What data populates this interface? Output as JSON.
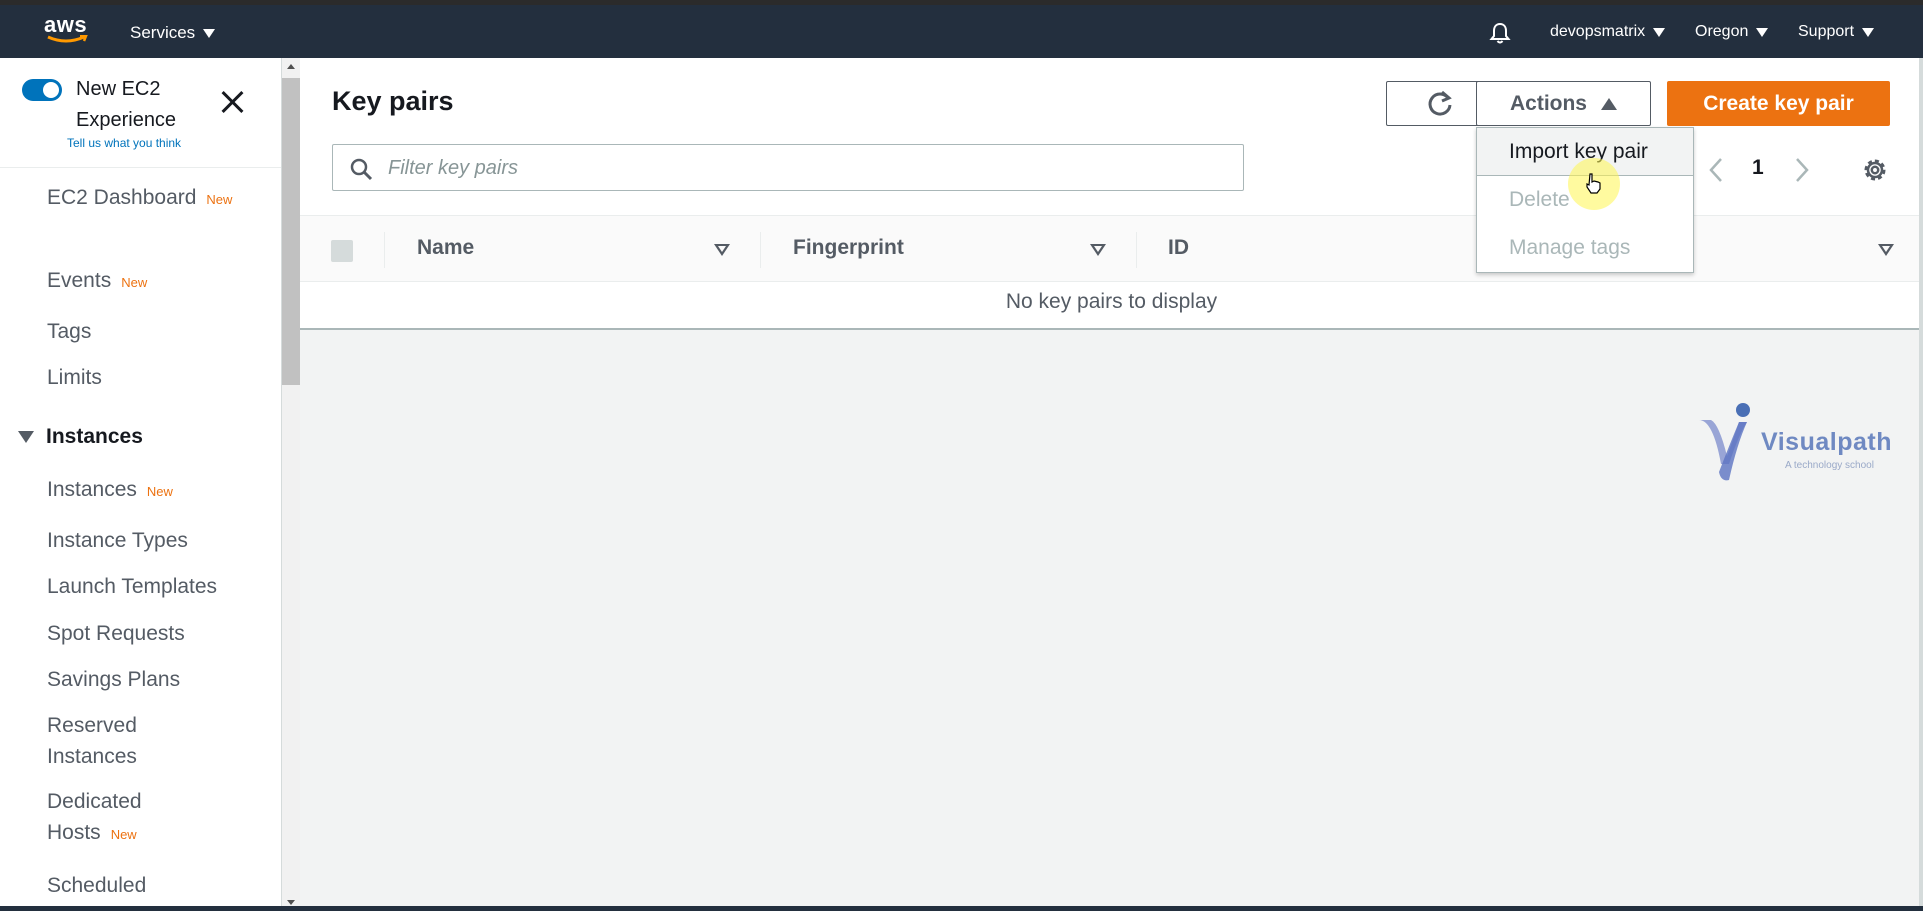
{
  "topbar": {
    "logo_text": "aws",
    "services_label": "Services",
    "account_label": "devopsmatrix",
    "region_label": "Oregon",
    "support_label": "Support"
  },
  "sidebar": {
    "experience_title": "New EC2 Experience",
    "experience_link": "Tell us what you think",
    "new_badge": "New",
    "items": [
      {
        "label": "EC2 Dashboard",
        "badge": "New"
      },
      {
        "label": "Events",
        "badge": "New"
      },
      {
        "label": "Tags",
        "badge": ""
      },
      {
        "label": "Limits",
        "badge": ""
      }
    ],
    "group_label": "Instances",
    "group_items": [
      {
        "label": "Instances",
        "badge": "New"
      },
      {
        "label": "Instance Types",
        "badge": ""
      },
      {
        "label": "Launch Templates",
        "badge": ""
      },
      {
        "label": "Spot Requests",
        "badge": ""
      },
      {
        "label": "Savings Plans",
        "badge": ""
      },
      {
        "label": "Reserved Instances",
        "badge": ""
      },
      {
        "label": "Dedicated Hosts",
        "badge": "New"
      },
      {
        "label": "Scheduled",
        "badge": ""
      }
    ]
  },
  "main": {
    "title": "Key pairs",
    "actions_label": "Actions",
    "create_label": "Create key pair",
    "search_placeholder": "Filter key pairs",
    "page_number": "1",
    "columns": [
      "Name",
      "Fingerprint",
      "ID"
    ],
    "empty_message": "No key pairs to display"
  },
  "actions_menu": {
    "items": [
      {
        "label": "Import key pair",
        "enabled": true
      },
      {
        "label": "Delete",
        "enabled": false
      },
      {
        "label": "Manage tags",
        "enabled": false
      }
    ]
  },
  "watermark": {
    "brand": "Visualpath",
    "tagline": "A technology school"
  },
  "colors": {
    "nav_bg": "#232f3e",
    "accent_orange": "#ec7211",
    "link_blue": "#0073bb"
  }
}
